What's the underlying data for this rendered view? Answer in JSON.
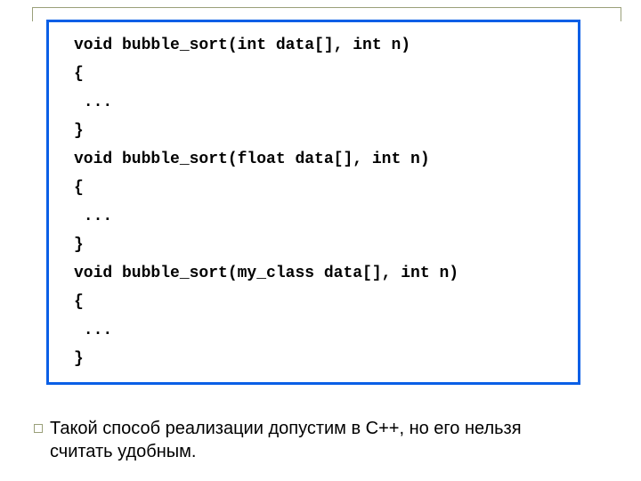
{
  "code": {
    "lines": [
      "void bubble_sort(int data[], int n)",
      "{",
      " ...",
      "}",
      "void bubble_sort(float data[], int n)",
      "{",
      " ...",
      "}",
      "void bubble_sort(my_class data[], int n)",
      "{",
      " ...",
      "}"
    ]
  },
  "caption": "Такой способ реализации допустим в C++, но его нельзя считать удобным."
}
